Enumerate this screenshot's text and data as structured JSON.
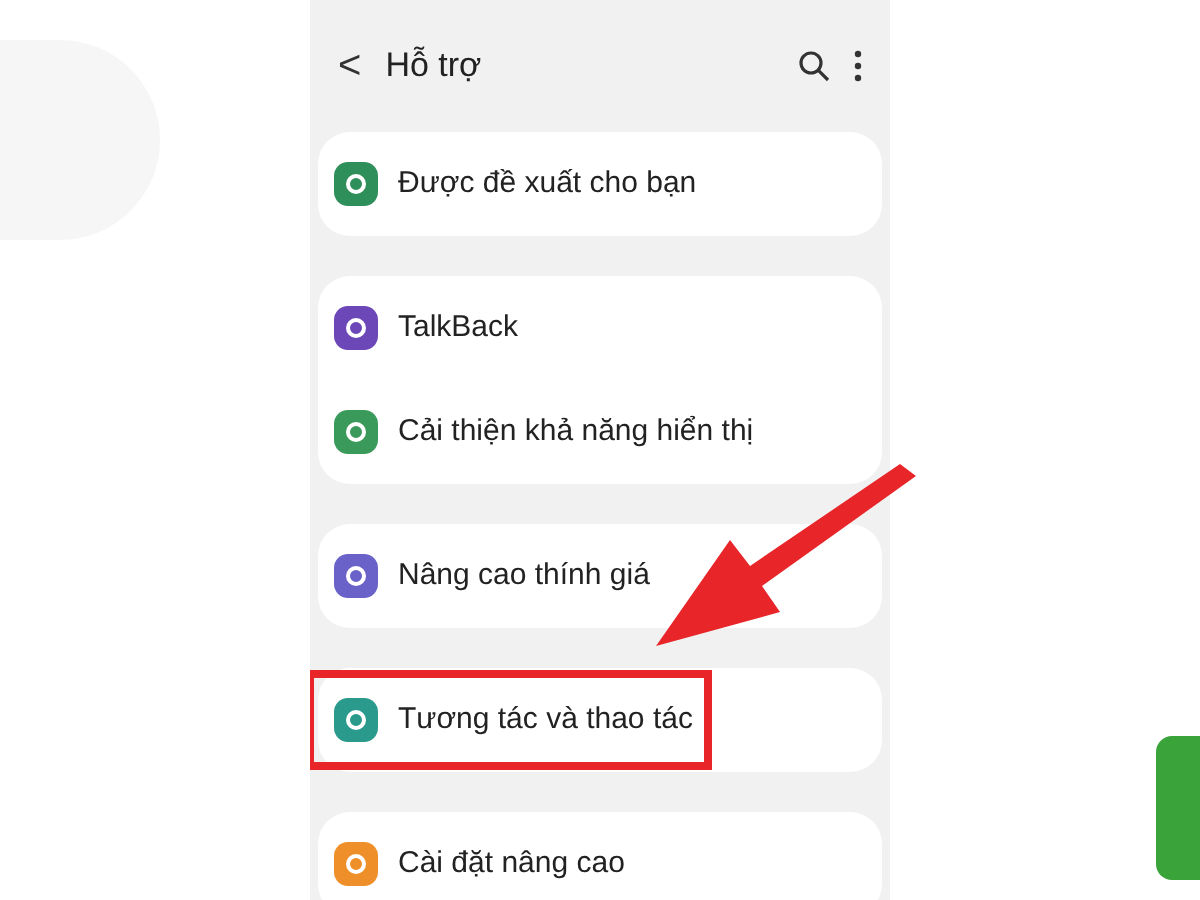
{
  "header": {
    "back": "<",
    "title": "Hỗ trợ"
  },
  "groups": [
    {
      "items": [
        {
          "label": "Được đề xuất cho bạn",
          "color": "#2f8f5b",
          "highlighted": false
        }
      ]
    },
    {
      "items": [
        {
          "label": "TalkBack",
          "color": "#6b47b8",
          "highlighted": false
        },
        {
          "label": "Cải thiện khả năng hiển thị",
          "color": "#3a9a5c",
          "highlighted": false
        }
      ]
    },
    {
      "items": [
        {
          "label": "Nâng cao thính giá",
          "color": "#6a62c8",
          "highlighted": false
        }
      ]
    },
    {
      "items": [
        {
          "label": "Tương tác và thao tác",
          "color": "#2a9a8c",
          "highlighted": true
        }
      ]
    },
    {
      "items": [
        {
          "label": "Cài đặt nâng cao",
          "color": "#ef8f2a",
          "highlighted": false
        }
      ]
    }
  ]
}
